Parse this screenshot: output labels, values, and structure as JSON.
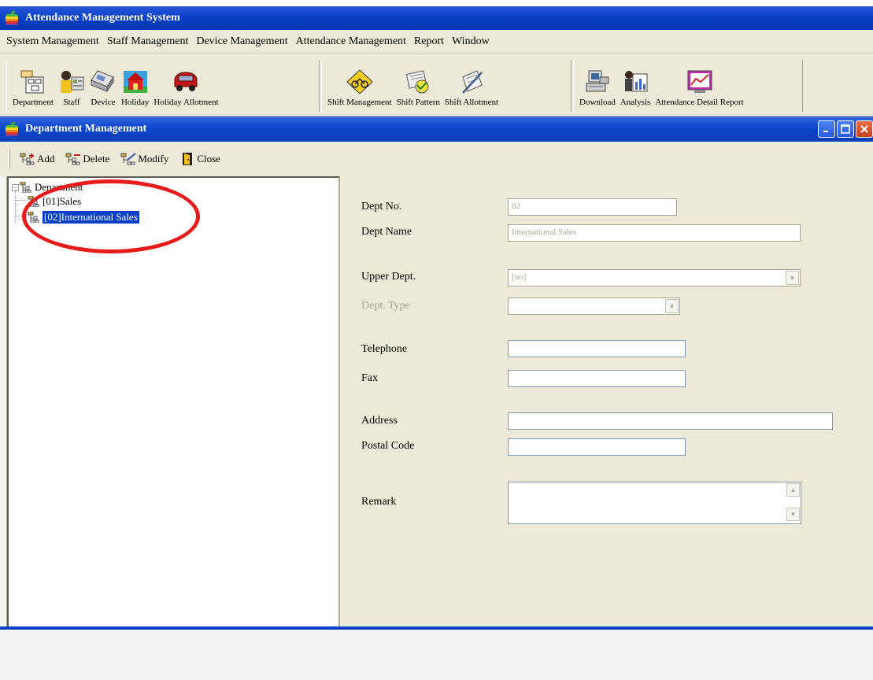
{
  "app": {
    "title": "Attendance Management System"
  },
  "menu": [
    "System Management",
    "Staff Management",
    "Device Management",
    "Attendance Management",
    "Report",
    "Window"
  ],
  "toolbar": {
    "department": "Department",
    "staff": "Staff",
    "device": "Device",
    "holiday": "Holiday",
    "holiday_allotment": "Holiday Allotment",
    "shift_management": "Shift Management",
    "shift_pattern": "Shift Pattern",
    "shift_allotment": "Shift Allotment",
    "download": "Download",
    "analysis": "Analysis",
    "attendance_detail_report": "Attendance Detail Report"
  },
  "window": {
    "title": "Department Management"
  },
  "actions": {
    "add": "Add",
    "delete": "Delete",
    "modify": "Modify",
    "close": "Close"
  },
  "tree": {
    "root": "Department",
    "expander": "−",
    "items": [
      "[01]Sales",
      "[02]International Sales"
    ]
  },
  "form": {
    "dept_no_label": "Dept No.",
    "dept_no_value": "02",
    "dept_name_label": "Dept Name",
    "dept_name_value": "International Sales",
    "upper_dept_label": "Upper Dept.",
    "upper_dept_value": "[no]",
    "dept_type_label": "Dept. Type",
    "dept_type_value": "",
    "telephone_label": "Telephone",
    "fax_label": "Fax",
    "address_label": "Address",
    "postal_code_label": "Postal Code",
    "remark_label": "Remark"
  },
  "colors": {
    "titlebar": "#0a3fc8",
    "selection": "#0a3fc8",
    "highlight_oval": "#e81a1a",
    "chrome": "#ece9d8"
  },
  "icons": [
    "app-icon",
    "department-icon",
    "staff-icon",
    "device-icon",
    "holiday-icon",
    "holiday-allotment-icon",
    "shift-management-icon",
    "shift-pattern-icon",
    "shift-allotment-icon",
    "download-icon",
    "analysis-icon",
    "attendance-report-icon",
    "add-icon",
    "delete-icon",
    "modify-icon",
    "close-door-icon",
    "tree-node-icon",
    "minimize-icon",
    "maximize-icon",
    "close-icon"
  ]
}
